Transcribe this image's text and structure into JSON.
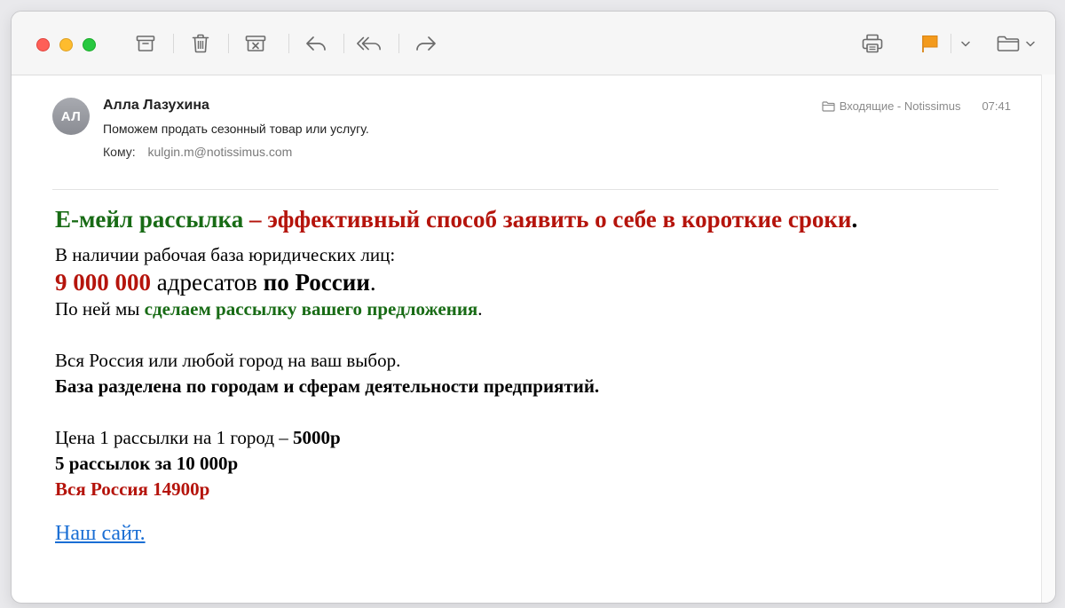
{
  "toolbar": {
    "buttons": [
      {
        "name": "archive-icon"
      },
      {
        "name": "trash-icon"
      },
      {
        "name": "junk-icon"
      },
      {
        "name": "reply-icon"
      },
      {
        "name": "reply-all-icon"
      },
      {
        "name": "forward-icon"
      },
      {
        "name": "print-icon"
      },
      {
        "name": "flag-icon"
      },
      {
        "name": "move-folder-icon"
      }
    ],
    "flag_color": "#f39a1c"
  },
  "message": {
    "avatar_initials": "АЛ",
    "sender": "Алла Лазухина",
    "subject": "Поможем продать сезонный товар или услугу.",
    "to_label": "Кому:",
    "to_address": "kulgin.m@notissimus.com",
    "mailbox": "Входящие - Notissimus",
    "time": "07:41"
  },
  "body": {
    "headline_green": "Е-мейл рассылка",
    "headline_red": " – эффективный способ заявить о себе в короткие сроки",
    "headline_end": ".",
    "line1": "В наличии рабочая база юридических лиц:",
    "line2_count": "9 000 000",
    "line2_mid": " адресатов ",
    "line2_bold": "по России",
    "line2_end": ".",
    "line3_start": "По ней мы ",
    "line3_green": "сделаем рассылку вашего предложения",
    "line3_end": ".",
    "line4": "Вся Россия или любой город на ваш выбор.",
    "line5": "База разделена по городам и сферам деятельности предприятий.",
    "price1_start": "Цена 1 рассылки на 1 город – ",
    "price1_bold": "5000р",
    "price2": "5 рассылок за 10 000р",
    "price3": "Вся Россия 14900р",
    "link": "Наш сайт."
  },
  "colors": {
    "green": "#186b15",
    "red": "#b5140c",
    "link": "#1a6ed4"
  }
}
